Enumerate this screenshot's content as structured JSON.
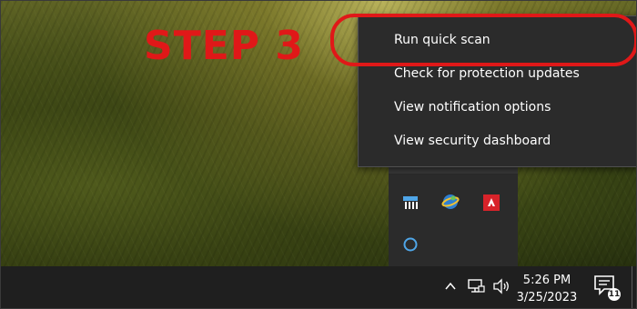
{
  "annotation": {
    "step_label": "STEP 3"
  },
  "context_menu": {
    "items": [
      {
        "label": "Run quick scan"
      },
      {
        "label": "Check for protection updates"
      },
      {
        "label": "View notification options"
      },
      {
        "label": "View security dashboard"
      }
    ]
  },
  "tray_overflow": {
    "icons": [
      "dashboard-icon",
      "network-globe-icon",
      "amd-icon",
      "cortana-circle-icon"
    ]
  },
  "taskbar": {
    "time": "5:26 PM",
    "date": "3/25/2023",
    "notification_count": "11",
    "icons": [
      "chevron-up-icon",
      "network-icon",
      "volume-icon",
      "action-center-icon"
    ]
  },
  "colors": {
    "highlight": "#e01818",
    "menu_bg": "#2b2b2b",
    "taskbar_bg": "#1f1f1f"
  }
}
